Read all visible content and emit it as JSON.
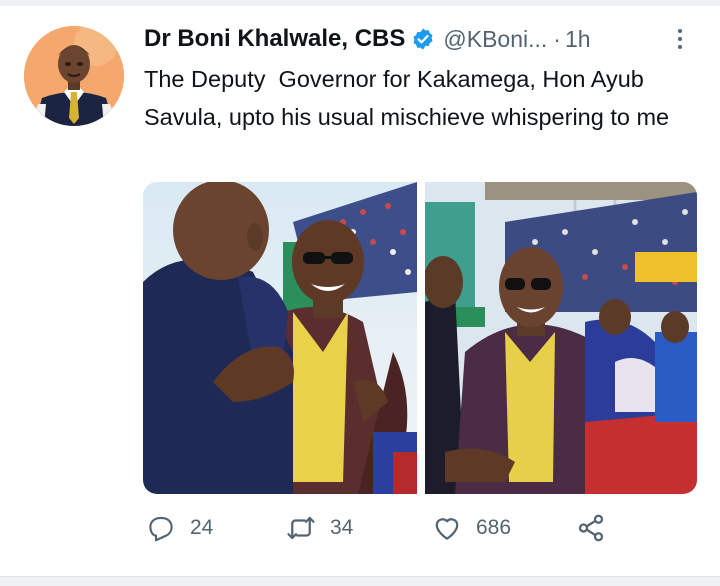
{
  "tweet": {
    "author_name": "Dr Boni Khalwale, CBS",
    "handle": "@KBoni...",
    "separator": "·",
    "time": "1h",
    "text": "The Deputy  Governor for Kakamega, Hon Ayub Savula, upto his usual mischieve whispering to me",
    "verified": true
  },
  "actions": {
    "replies": "24",
    "retweets": "34",
    "likes": "686"
  },
  "icons": {
    "verified": "verified-badge-icon",
    "more": "more-options-icon",
    "reply": "reply-icon",
    "retweet": "retweet-icon",
    "like": "heart-icon",
    "share": "share-icon"
  },
  "colors": {
    "verified": "#1d9bf0",
    "text": "#0f1419",
    "secondary": "#536471",
    "avatar_bg": "#f4a86d"
  }
}
